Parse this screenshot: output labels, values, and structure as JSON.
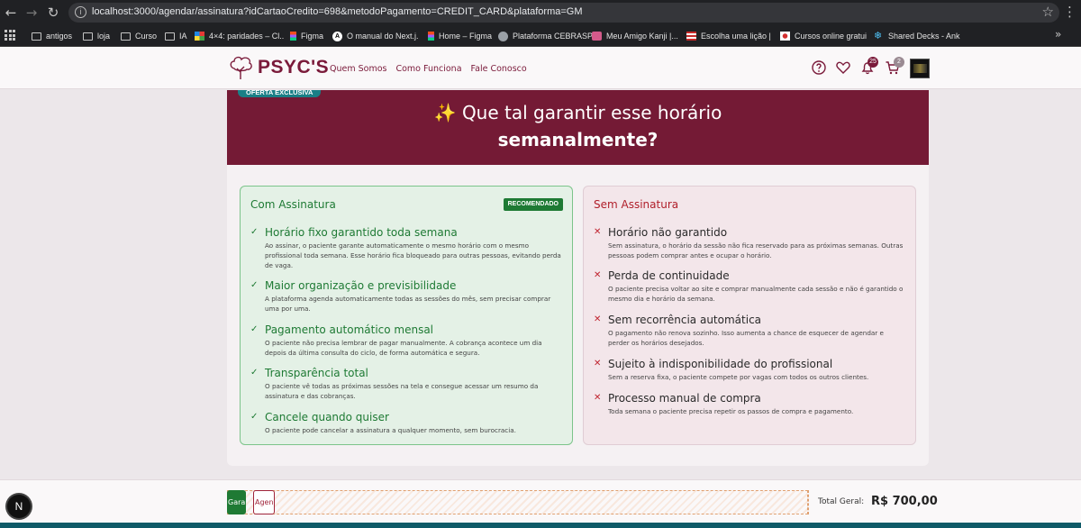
{
  "browser": {
    "url": "localhost:3000/agendar/assinatura?idCartaoCredito=698&metodoPagamento=CREDIT_CARD&plataforma=GM",
    "bookmarks": [
      {
        "label": "antigos",
        "icon": "folder-icon"
      },
      {
        "label": "loja",
        "icon": "folder-icon"
      },
      {
        "label": "Curso",
        "icon": "folder-icon"
      },
      {
        "label": "IA",
        "icon": "folder-icon"
      },
      {
        "label": "4×4: paridades – Cl...",
        "icon": "cube-icon"
      },
      {
        "label": "Figma",
        "icon": "figma-icon"
      },
      {
        "label": "O manual do Next.j...",
        "icon": "nextjs-icon"
      },
      {
        "label": "Home – Figma",
        "icon": "figma-icon"
      },
      {
        "label": "Plataforma CEBRASPE",
        "icon": "globe-icon"
      },
      {
        "label": "Meu Amigo Kanji   |...",
        "icon": "kanji-icon"
      },
      {
        "label": "Escolha uma lição |...",
        "icon": "flag-icon"
      },
      {
        "label": "Cursos online gratui...",
        "icon": "japan-flag-icon"
      },
      {
        "label": "Shared Decks - Anki...",
        "icon": "anki-icon"
      }
    ]
  },
  "header": {
    "brand": "PSYC'S",
    "nav": [
      "Quem Somos",
      "Como Funciona",
      "Fale Conosco"
    ],
    "notifications_count": "25",
    "cart_count": "2",
    "brand_color": "#7a1a3a"
  },
  "hero": {
    "tag": "OFERTA EXCLUSIVA",
    "line1": "Que tal garantir esse horário",
    "line2": "semanalmente?",
    "sparkle": "✨"
  },
  "with_subscription": {
    "title": "Com Assinatura",
    "badge": "RECOMENDADO",
    "items": [
      {
        "title": "Horário fixo garantido toda semana",
        "desc": "Ao assinar, o paciente garante automaticamente o mesmo horário com o mesmo profissional toda semana. Esse horário fica bloqueado para outras pessoas, evitando perda de vaga."
      },
      {
        "title": "Maior organização e previsibilidade",
        "desc": "A plataforma agenda automaticamente todas as sessões do mês, sem precisar comprar uma por uma."
      },
      {
        "title": "Pagamento automático mensal",
        "desc": "O paciente não precisa lembrar de pagar manualmente. A cobrança acontece um dia depois da última consulta do ciclo, de forma automática e segura."
      },
      {
        "title": "Transparência total",
        "desc": "O paciente vê todas as próximas sessões na tela e consegue acessar um resumo da assinatura e das cobranças."
      },
      {
        "title": "Cancele quando quiser",
        "desc": "O paciente pode cancelar a assinatura a qualquer momento, sem burocracia."
      }
    ]
  },
  "without_subscription": {
    "title": "Sem Assinatura",
    "items": [
      {
        "title": "Horário não garantido",
        "desc": "Sem assinatura, o horário da sessão não fica reservado para as próximas semanas. Outras pessoas podem comprar antes e ocupar o horário."
      },
      {
        "title": "Perda de continuidade",
        "desc": "O paciente precisa voltar ao site e comprar manualmente cada sessão e não é garantido o mesmo dia e horário da semana."
      },
      {
        "title": "Sem recorrência automática",
        "desc": "O pagamento não renova sozinho. Isso aumenta a chance de esquecer de agendar e perder os horários desejados."
      },
      {
        "title": "Sujeito à indisponibilidade do profissional",
        "desc": "Sem a reserva fixa, o paciente compete por vagas com todos os outros clientes."
      },
      {
        "title": "Processo manual de compra",
        "desc": "Toda semana o paciente precisa repetir os passos de compra e pagamento."
      }
    ]
  },
  "footer": {
    "subscribe_label": "Garantir meu horário",
    "no_subscribe_label": "Agendar sem assinatura",
    "total_label": "Total Geral:",
    "total_value": "R$ 700,00",
    "dev_badge": "N"
  }
}
